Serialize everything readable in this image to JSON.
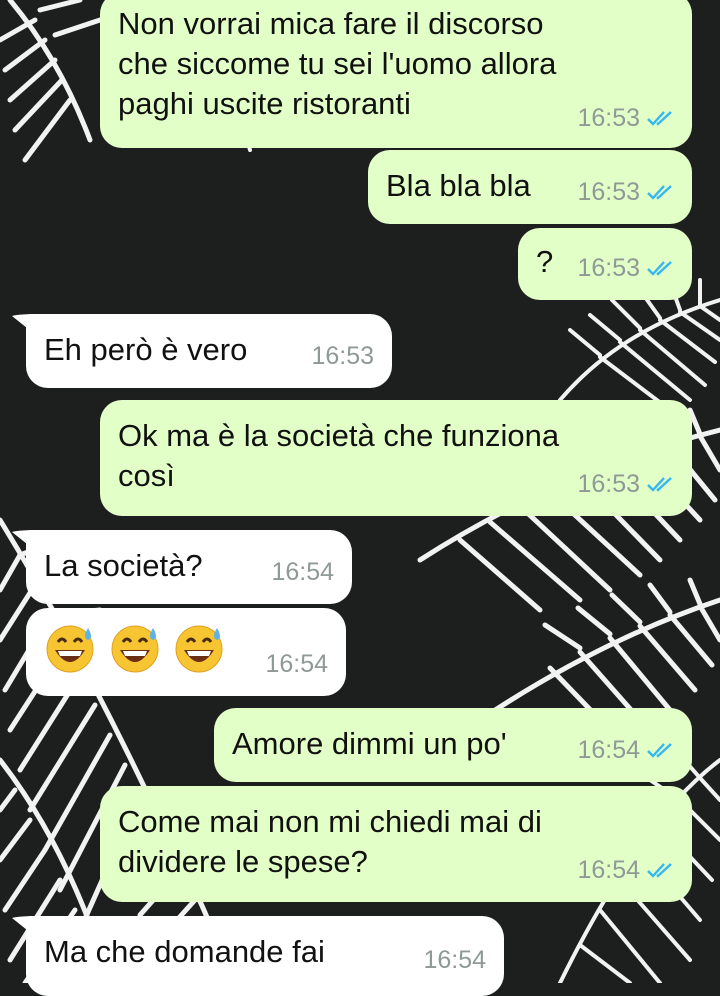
{
  "messages": [
    {
      "direction": "outgoing",
      "text": "Non vorrai mica fare il discorso\nche siccome tu sei l'uomo allora\npaghi uscite ristoranti",
      "time": "16:53",
      "status": "read"
    },
    {
      "direction": "outgoing",
      "text": "Bla bla bla",
      "time": "16:53",
      "status": "read"
    },
    {
      "direction": "outgoing",
      "text": "?",
      "time": "16:53",
      "status": "read"
    },
    {
      "direction": "incoming",
      "text": "Eh però è vero",
      "time": "16:53"
    },
    {
      "direction": "outgoing",
      "text": "Ok ma è la società che funziona\ncosì",
      "time": "16:53",
      "status": "read"
    },
    {
      "direction": "incoming",
      "text": "La società?",
      "time": "16:54"
    },
    {
      "direction": "incoming",
      "text": "",
      "emoji": [
        "grinning-face-with-sweat",
        "grinning-face-with-sweat",
        "grinning-face-with-sweat"
      ],
      "time": "16:54"
    },
    {
      "direction": "outgoing",
      "text": "Amore dimmi un po'",
      "time": "16:54",
      "status": "read"
    },
    {
      "direction": "outgoing",
      "text": "Come mai non mi chiedi mai di\ndividere le spese?",
      "time": "16:54",
      "status": "read"
    },
    {
      "direction": "incoming",
      "text": "Ma che domande fai",
      "time": "16:54"
    }
  ],
  "colors": {
    "outgoing_bubble": "#e2ffc7",
    "incoming_bubble": "#ffffff",
    "read_tick": "#34b7f1",
    "timestamp": "#8f9995",
    "wallpaper": "#1c1f1e"
  },
  "icons": {
    "read_status": "double-check-icon",
    "wallpaper": "palm-leaves-pattern"
  }
}
